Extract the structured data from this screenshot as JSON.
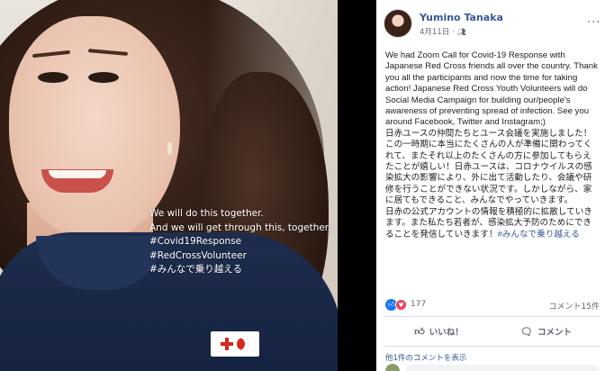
{
  "photo": {
    "caption_lines": [
      "We will do this together.",
      "And we will get through this, together.",
      "#Covid19Response",
      "#RedCrossVolunteer",
      "#みんなで乗り越える"
    ]
  },
  "post": {
    "author": "Yumino Tanaka",
    "date": "4月11日",
    "body_en": "We had Zoom Call for Covid-19 Response with Japanese Red Cross friends all over the country. Thank you all the participants and now the time for taking action! Japanese Red Cross Youth Volunteers will do Social Media Campaign for building our/people's awareness of preventing spread of infection. See you around Facebook, Twitter and Instagram;)",
    "body_ja_1": "日赤ユースの仲間たちとユース会議を実施しました！この一時期に本当にたくさんの人が準備に関わってくれて、またそれ以上のたくさんの方に参加してもらえたことが嬉しい！日赤ユースは、コロナウイルスの感染拡大の影響により、外に出て活動したり、会議や研修を行うことができない状況です。しかしながら、家に居てもできること、みんなでやっていきます。",
    "body_ja_2_prefix": "日赤の公式アカウントの情報を積極的に拡散していきます。また私たち若者が、感染拡大予防のためにできることを発信していきます！",
    "hashtag": "#みんなで乗り越える"
  },
  "reactions": {
    "count": "177",
    "comments": "コメント15件"
  },
  "actions": {
    "like": "いいね！",
    "comment": "コメント"
  },
  "footer": {
    "prev_comments": "他1件のコメントを表示"
  },
  "colors": {
    "link": "#385898",
    "like_blue": "#1877f2",
    "love_red": "#f33e58",
    "shirt_navy": "#1e2c4d",
    "red_cross": "#d6281f"
  }
}
